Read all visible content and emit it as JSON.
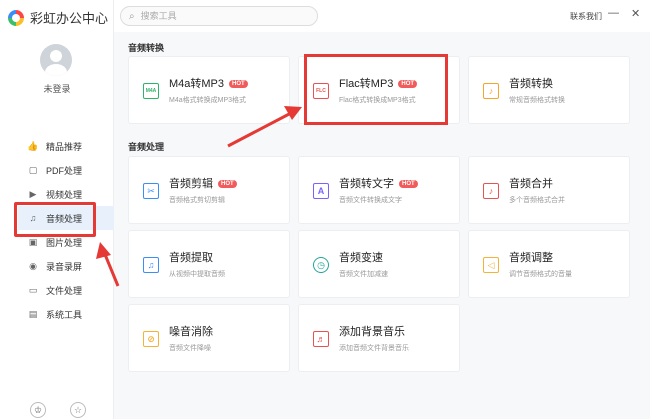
{
  "app": {
    "title": "彩虹办公中心"
  },
  "user": {
    "login_label": "未登录"
  },
  "search": {
    "placeholder": "搜索工具"
  },
  "topbar": {
    "contact": "联系我们",
    "minimize": "—",
    "close": "✕"
  },
  "sidebar": {
    "items": [
      {
        "label": "精品推荐",
        "icon": "thumbs-up-icon",
        "glyph": "👍"
      },
      {
        "label": "PDF处理",
        "icon": "pdf-icon",
        "glyph": "▢"
      },
      {
        "label": "视频处理",
        "icon": "video-icon",
        "glyph": "▶"
      },
      {
        "label": "音频处理",
        "icon": "music-icon",
        "glyph": "♫",
        "active": true
      },
      {
        "label": "图片处理",
        "icon": "image-icon",
        "glyph": "▣"
      },
      {
        "label": "录音录屏",
        "icon": "record-icon",
        "glyph": "◉"
      },
      {
        "label": "文件处理",
        "icon": "folder-icon",
        "glyph": "▭"
      },
      {
        "label": "系统工具",
        "icon": "monitor-icon",
        "glyph": "▤"
      }
    ]
  },
  "sections": {
    "convert": {
      "title": "音频转换"
    },
    "process": {
      "title": "音频处理"
    }
  },
  "cards": [
    {
      "title": "M4a转MP3",
      "desc": "M4a格式转换成MP3格式",
      "hot": "HOT",
      "icon": "m4a-file-icon",
      "glyph": "M4A"
    },
    {
      "title": "Flac转MP3",
      "desc": "Flac格式转换成MP3格式",
      "hot": "HOT",
      "icon": "flac-file-icon",
      "glyph": "FLC"
    },
    {
      "title": "音频转换",
      "desc": "常规音频格式转换",
      "hot": "",
      "icon": "audio-convert-icon",
      "glyph": "♪"
    },
    {
      "title": "音频剪辑",
      "desc": "音频格式剪切剪辑",
      "hot": "HOT",
      "icon": "audio-cut-icon",
      "glyph": "✂"
    },
    {
      "title": "音频转文字",
      "desc": "音频文件转换成文字",
      "hot": "HOT",
      "icon": "audio-to-text-icon",
      "glyph": "A"
    },
    {
      "title": "音频合并",
      "desc": "多个音频格式合并",
      "hot": "",
      "icon": "audio-merge-icon",
      "glyph": "♪"
    },
    {
      "title": "音频提取",
      "desc": "从视频中提取音频",
      "hot": "",
      "icon": "audio-extract-icon",
      "glyph": "♫"
    },
    {
      "title": "音频变速",
      "desc": "音频文件加减速",
      "hot": "",
      "icon": "speed-icon",
      "glyph": "◷"
    },
    {
      "title": "音频调整",
      "desc": "调节音频格式的音量",
      "hot": "",
      "icon": "volume-icon",
      "glyph": "◁"
    },
    {
      "title": "噪音消除",
      "desc": "音频文件降噪",
      "hot": "",
      "icon": "noise-reduce-icon",
      "glyph": "⊘"
    },
    {
      "title": "添加背景音乐",
      "desc": "添加音频文件背景音乐",
      "hot": "",
      "icon": "bgm-icon",
      "glyph": "♬"
    }
  ],
  "colors": {
    "accent": "#3a8ef6",
    "hot": "#f25b5b",
    "highlight": "#e53935"
  }
}
